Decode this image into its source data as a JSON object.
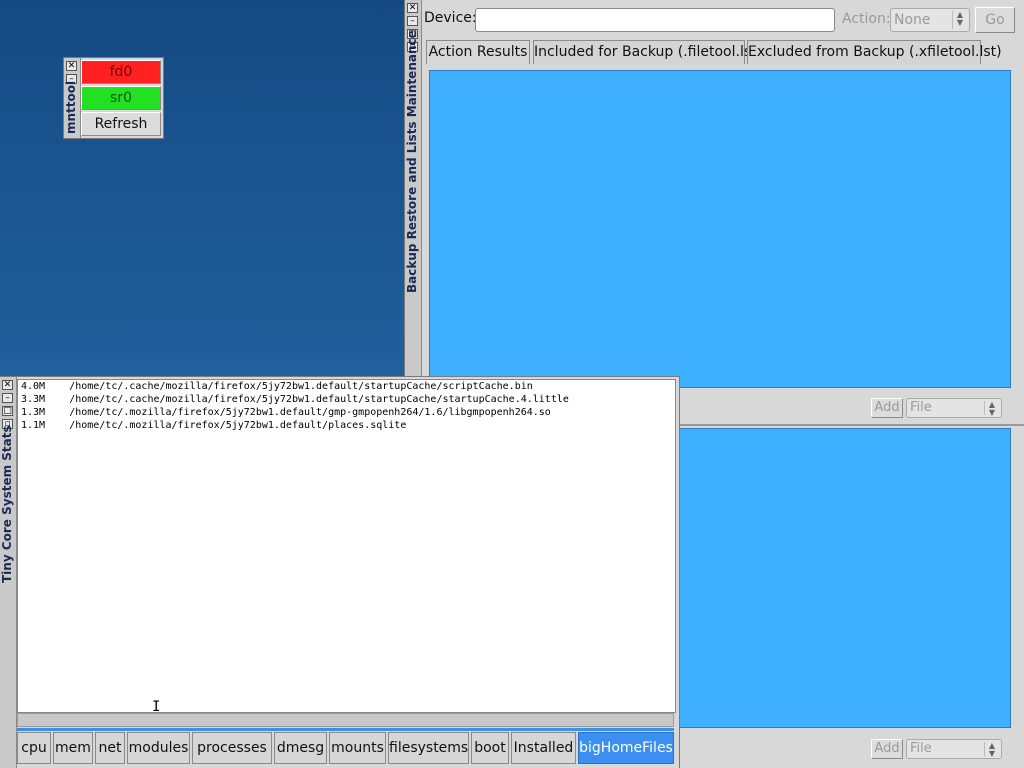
{
  "mnttool": {
    "title": "mnttool",
    "buttons": [
      {
        "label": "fd0",
        "color": "#ff2020"
      },
      {
        "label": "sr0",
        "color": "#22e022"
      },
      {
        "label": "Refresh",
        "color": "#dcdcdc"
      }
    ]
  },
  "backup": {
    "title": "Backup Restore and Lists Maintenance",
    "device_label": "Device:",
    "device_value": "",
    "action_label": "Action:",
    "action_value": "None",
    "go_label": "Go",
    "tabs": [
      "Action Results",
      "Included for Backup (.filetool.lst)",
      "Excluded from Backup (.xfiletool.lst)"
    ],
    "active_tab": "Action Results",
    "add_label": "Add",
    "file_label": "File",
    "pane_color": "#3fb0ff"
  },
  "stats": {
    "title": "Tiny Core System Stats",
    "rows": [
      {
        "size": "4.0M",
        "path": "/home/tc/.cache/mozilla/firefox/5jy72bw1.default/startupCache/scriptCache.bin"
      },
      {
        "size": "3.3M",
        "path": "/home/tc/.cache/mozilla/firefox/5jy72bw1.default/startupCache/startupCache.4.little"
      },
      {
        "size": "1.3M",
        "path": "/home/tc/.mozilla/firefox/5jy72bw1.default/gmp-gmpopenh264/1.6/libgmpopenh264.so"
      },
      {
        "size": "1.1M",
        "path": "/home/tc/.mozilla/firefox/5jy72bw1.default/places.sqlite"
      }
    ],
    "tabs": [
      "cpu",
      "mem",
      "net",
      "modules",
      "processes",
      "dmesg",
      "mounts",
      "filesystems",
      "boot",
      "Installed",
      "bigHomeFiles"
    ],
    "active_tab": "bigHomeFiles",
    "active_color": "#3a8ff0"
  }
}
